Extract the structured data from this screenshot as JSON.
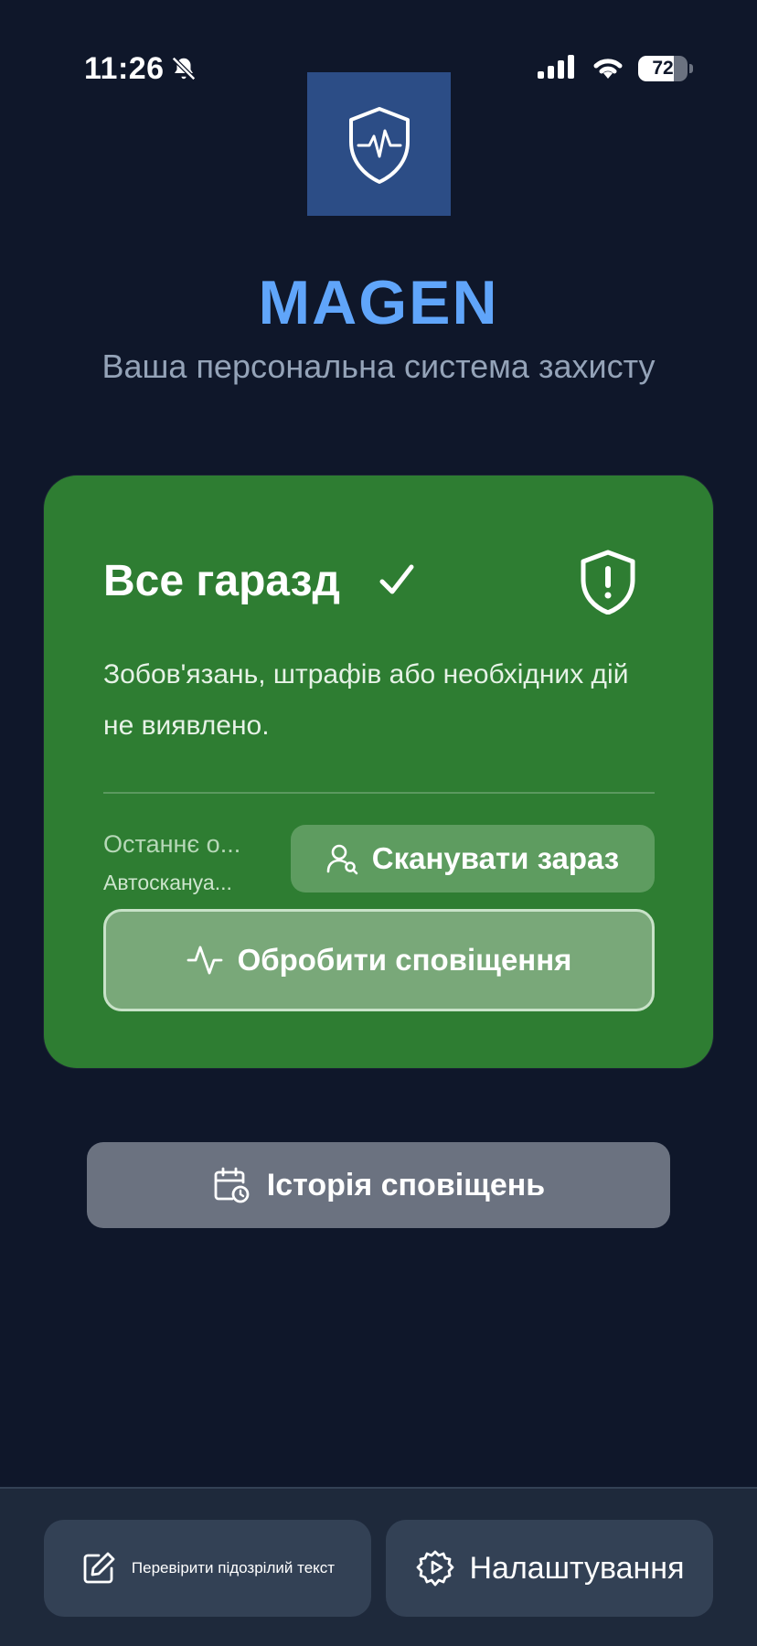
{
  "status_bar": {
    "time": "11:26",
    "battery_percent": 72,
    "icons": [
      "bell-slash-icon",
      "signal-icon",
      "wifi-icon",
      "battery-icon"
    ]
  },
  "app": {
    "name": "MAGEN",
    "tagline": "Ваша персональна система захисту",
    "logo_icon": "shield-heartbeat-icon",
    "accent_color": "#60a5fa"
  },
  "status_card": {
    "title": "Все гаразд",
    "title_icon": "checkmark-icon",
    "status_icon": "shield-alert-icon",
    "description": "Зобов'язань, штрафів або необхідних дій не виявлено.",
    "last_scan_label": "Останнє о...",
    "auto_scan_label": "Автоскануа...",
    "scan_button_label": "Сканувати зараз",
    "scan_button_icon": "user-search-icon",
    "process_button_label": "Обробити сповіщення",
    "process_button_icon": "activity-icon",
    "background_color": "#2e7d32"
  },
  "history_button": {
    "label": "Історія сповіщень",
    "icon": "calendar-clock-icon"
  },
  "bottom_nav": {
    "check_text_label": "Перевірити підозрілий текст",
    "check_text_icon": "edit-icon",
    "settings_label": "Налаштування",
    "settings_icon": "gear-icon"
  }
}
